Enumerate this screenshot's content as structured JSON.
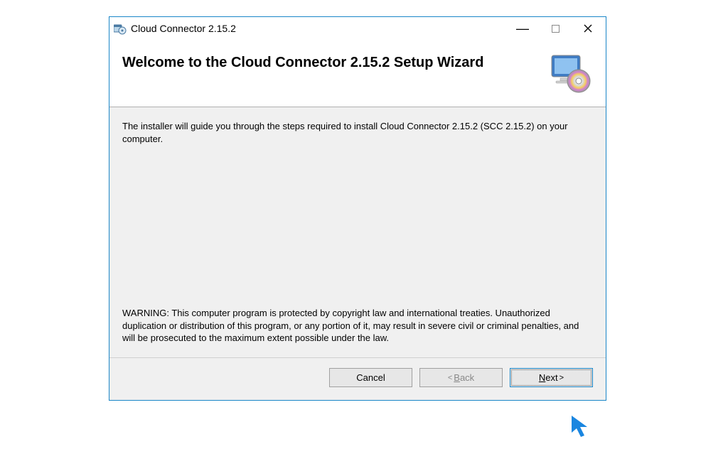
{
  "window": {
    "title": "Cloud Connector 2.15.2"
  },
  "header": {
    "heading": "Welcome to the Cloud Connector 2.15.2 Setup Wizard"
  },
  "content": {
    "intro_text": "The installer will guide you through the steps required to install Cloud Connector 2.15.2 (SCC 2.15.2) on your computer.",
    "warning_text": "WARNING: This computer program is protected by copyright law and international treaties. Unauthorized duplication or distribution of this program, or any portion of it, may result in severe civil or criminal penalties, and will be prosecuted to the maximum extent possible under the law."
  },
  "buttons": {
    "cancel": "Cancel",
    "back_mnemonic": "B",
    "back_rest": "ack",
    "next_mnemonic": "N",
    "next_rest": "ext"
  }
}
